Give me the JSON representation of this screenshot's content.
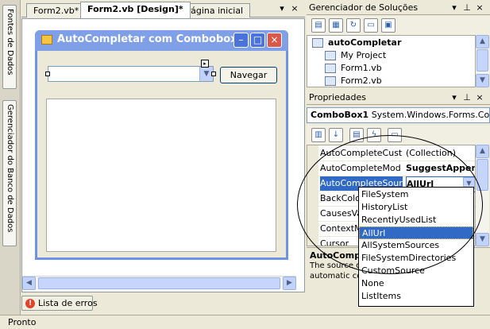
{
  "left_dock": {
    "tabs": [
      {
        "label": "Fontes de Dados",
        "icon": "database-icon"
      },
      {
        "label": "Gerenciador do Banco de Dados",
        "icon": "server-icon"
      }
    ]
  },
  "doc_tabs": [
    {
      "label": "Form2.vb*",
      "active": false
    },
    {
      "label": "Form2.vb [Design]*",
      "active": true
    },
    {
      "label": "Página inicial",
      "active": false
    }
  ],
  "doc_strip_buttons": {
    "menu": "▾",
    "close": "×"
  },
  "form": {
    "title": "AutoCompletar com Combobox",
    "icon": "form-icon",
    "navigate_button": "Navegar",
    "title_buttons": {
      "minimize": "–",
      "maximize": "□",
      "close": "×"
    },
    "combo_value": ""
  },
  "error_tab": {
    "label": "Lista de erros"
  },
  "status": {
    "text": "Pronto"
  },
  "solution_explorer": {
    "title": "Gerenciador de Soluções",
    "header_buttons": {
      "menu": "▾",
      "pin": "⊥",
      "close": "×"
    },
    "items": [
      {
        "label": "autoCompletar",
        "bold": true
      },
      {
        "label": "My Project",
        "bold": false
      },
      {
        "label": "Form1.vb",
        "bold": false
      },
      {
        "label": "Form2.vb",
        "bold": false
      }
    ]
  },
  "properties": {
    "title": "Propriedades",
    "header_buttons": {
      "menu": "▾",
      "pin": "⊥",
      "close": "×"
    },
    "object": {
      "name": "ComboBox1",
      "type": "System.Windows.Forms.Com"
    },
    "rows": [
      {
        "name": "AutoCompleteCust",
        "value": "(Collection)",
        "selected": false
      },
      {
        "name": "AutoCompleteMod",
        "value": "SuggestAppend",
        "selected": false
      },
      {
        "name": "AutoCompleteSour",
        "value": "AllUrl",
        "selected": true
      },
      {
        "name": "BackColor",
        "value": "",
        "selected": false
      },
      {
        "name": "CausesVal",
        "value": "",
        "selected": false
      },
      {
        "name": "ContextMe",
        "value": "",
        "selected": false
      },
      {
        "name": "Cursor",
        "value": "",
        "selected": false
      }
    ],
    "description": {
      "title": "AutoComple",
      "text": "The source o",
      "text2": "automatic co"
    }
  },
  "dropdown": {
    "items": [
      {
        "label": "FileSystem",
        "selected": false
      },
      {
        "label": "HistoryList",
        "selected": false
      },
      {
        "label": "RecentlyUsedList",
        "selected": false
      },
      {
        "label": "AllUrl",
        "selected": true
      },
      {
        "label": "AllSystemSources",
        "selected": false
      },
      {
        "label": "FileSystemDirectories",
        "selected": false
      },
      {
        "label": "CustomSource",
        "selected": false
      },
      {
        "label": "None",
        "selected": false
      },
      {
        "label": "ListItems",
        "selected": false
      }
    ]
  },
  "colors": {
    "selection": "#316ac5",
    "form_title": "#7f9fe7",
    "close_red": "#d8594a"
  }
}
